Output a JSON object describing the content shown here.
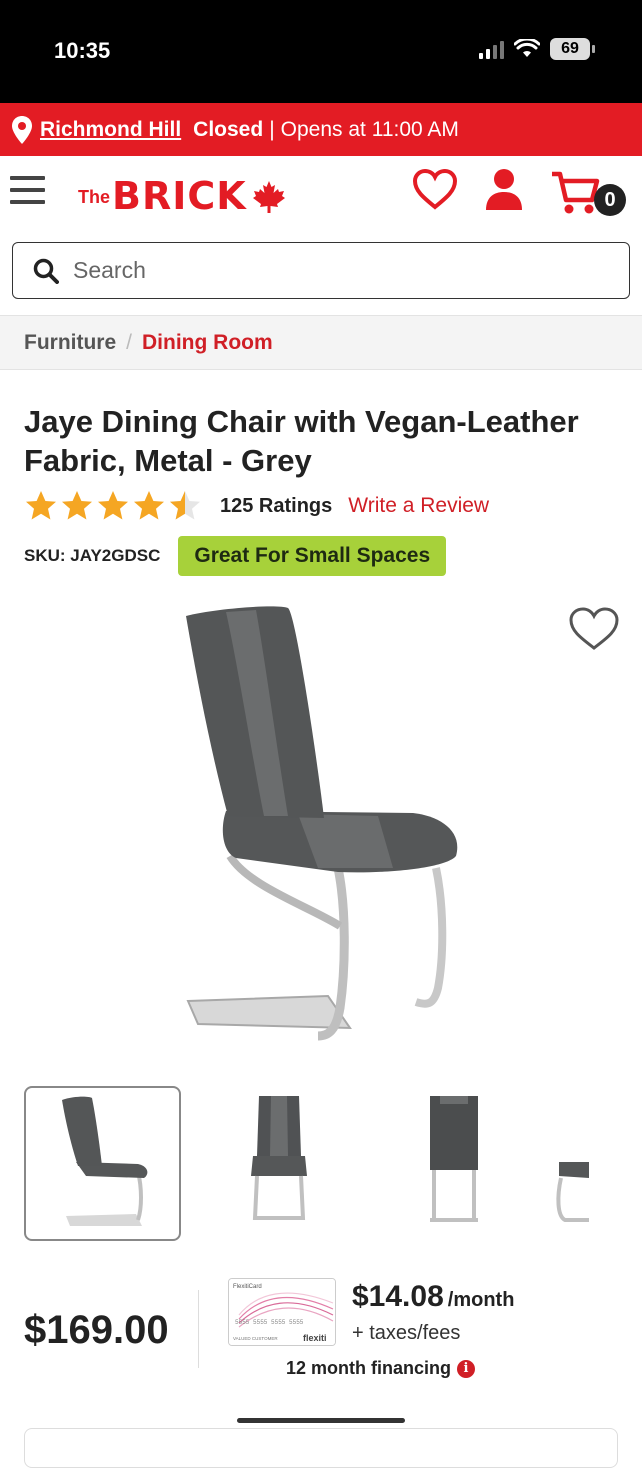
{
  "status_bar": {
    "time": "10:35",
    "battery": "69"
  },
  "store": {
    "name": "Richmond Hill",
    "status": "Closed",
    "separator": "|",
    "hours": "Opens at 11:00 AM"
  },
  "header": {
    "logo_the": "The",
    "logo_brick": "BRICK",
    "cart_count": "0"
  },
  "search": {
    "placeholder": "Search"
  },
  "breadcrumb": {
    "items": [
      "Furniture",
      "Dining Room"
    ],
    "separator": "/"
  },
  "product": {
    "title": "Jaye Dining Chair with Vegan-Leather Fabric, Metal - Grey",
    "rating": 4.5,
    "rating_count": "125 Ratings",
    "write_review": "Write a Review",
    "sku": "SKU: JAY2GDSC",
    "badge": "Great For Small Spaces",
    "price": "$169.00",
    "monthly_amount": "$14.08",
    "monthly_unit": "/month",
    "taxes": "+ taxes/fees",
    "financing": "12 month financing",
    "info_glyph": "i"
  },
  "card": {
    "brand": "FlexitiCard",
    "number": "5555 5555 5555 5555",
    "holder": "VALUED CUSTOMER",
    "logo": "flexiti"
  },
  "colors": {
    "brand_red": "#e31c24",
    "badge_green": "#a7d13a",
    "star_gold": "#f5a623"
  }
}
